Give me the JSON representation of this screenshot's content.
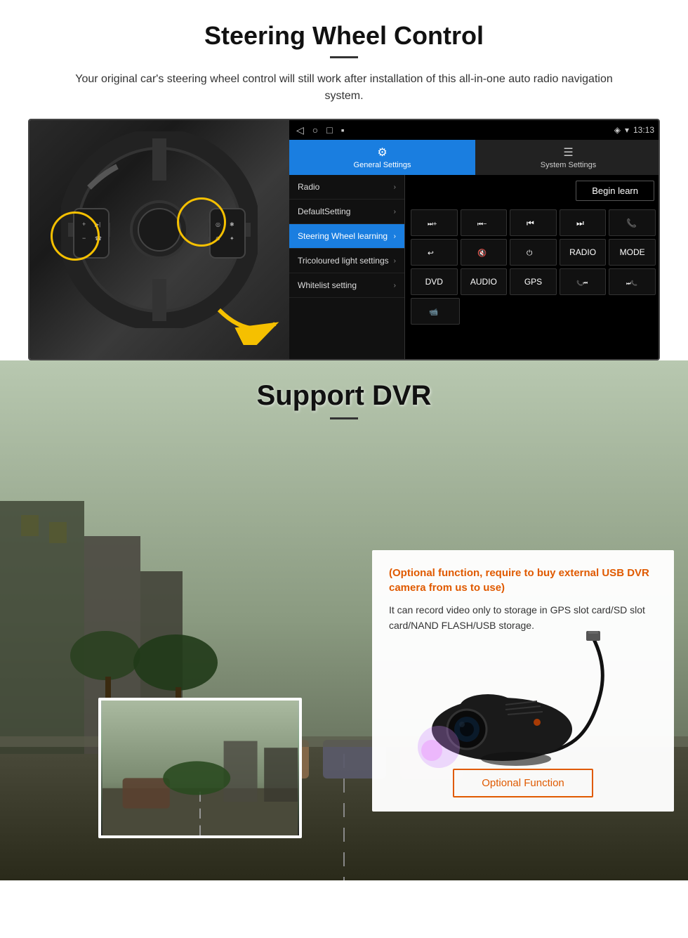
{
  "steering_section": {
    "title": "Steering Wheel Control",
    "subtitle": "Your original car's steering wheel control will still work after installation of this all-in-one auto radio navigation system.",
    "status_bar": {
      "nav_icons": [
        "◁",
        "○",
        "□",
        "▪"
      ],
      "signal": "▼",
      "wifi": "▾",
      "time": "13:13"
    },
    "tabs": [
      {
        "id": "general",
        "label": "General Settings",
        "active": true
      },
      {
        "id": "system",
        "label": "System Settings",
        "active": false
      }
    ],
    "menu_items": [
      {
        "label": "Radio",
        "active": false
      },
      {
        "label": "DefaultSetting",
        "active": false
      },
      {
        "label": "Steering Wheel learning",
        "active": true
      },
      {
        "label": "Tricoloured light settings",
        "active": false
      },
      {
        "label": "Whitelist setting",
        "active": false
      }
    ],
    "begin_learn_label": "Begin learn",
    "control_buttons": [
      [
        "vol+",
        "vol-",
        "prev_track",
        "next_track",
        "phone"
      ],
      [
        "hang_up",
        "mute",
        "power",
        "RADIO",
        "MODE"
      ],
      [
        "DVD",
        "AUDIO",
        "GPS",
        "tel_prev",
        "tel_next"
      ],
      [
        "cam"
      ]
    ]
  },
  "dvr_section": {
    "title": "Support DVR",
    "optional_text": "(Optional function, require to buy external USB DVR camera from us to use)",
    "description": "It can record video only to storage in GPS slot card/SD slot card/NAND FLASH/USB storage.",
    "optional_function_label": "Optional Function"
  }
}
